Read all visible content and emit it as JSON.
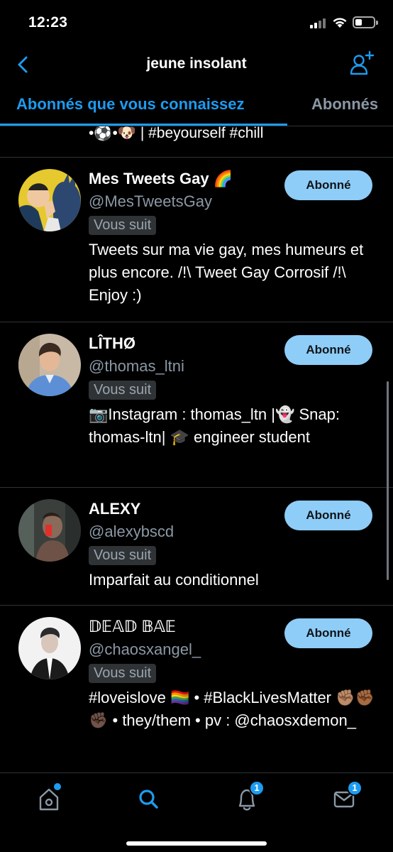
{
  "status_bar": {
    "time": "12:23"
  },
  "header": {
    "title": "jeune insolant",
    "back_icon": "chevron-left-icon",
    "add_icon": "add-user-icon"
  },
  "tabs": [
    {
      "label": "Abonnés que vous connaissez",
      "active": true
    },
    {
      "label": "Abonnés",
      "active": false
    }
  ],
  "previous_bio_tail": "•⚽•🐶 | #beyourself #chill",
  "users": [
    {
      "name": "Mes Tweets Gay 🌈",
      "handle": "@MesTweetsGay",
      "follows_you": "Vous suit",
      "bio": "Tweets sur ma vie gay, mes humeurs et plus encore. /!\\ Tweet Gay Corrosif /!\\ Enjoy :)",
      "button": "Abonné"
    },
    {
      "name": "LÎTHØ",
      "handle": "@thomas_ltni",
      "follows_you": "Vous suit",
      "bio": "📷Instagram : thomas_ltn |👻 Snap: thomas-ltn| 🎓 engineer student",
      "button": "Abonné"
    },
    {
      "name": "ALEXY",
      "handle": "@alexybscd",
      "follows_you": "Vous suit",
      "bio": "Imparfait au conditionnel",
      "button": "Abonné"
    },
    {
      "name": "𝔻𝔼𝔸𝔻 𝔹𝔸𝔼",
      "handle": "@chaosxangel_",
      "follows_you": "Vous suit",
      "bio": "#loveislove 🏳️‍🌈 • #BlackLivesMatter ✊🏽✊🏾✊🏿 • they/them • pv : @chaosxdemon_",
      "button": "Abonné"
    }
  ],
  "tabbar": {
    "items": [
      {
        "icon": "home-icon",
        "badge": ""
      },
      {
        "icon": "search-icon",
        "badge": ""
      },
      {
        "icon": "notifications-icon",
        "badge": "1"
      },
      {
        "icon": "messages-icon",
        "badge": "1"
      }
    ]
  },
  "colors": {
    "accent": "#1d9bf0",
    "button_bg": "#8ecdf8",
    "muted": "#8b98a5",
    "divider": "#2f3336"
  }
}
